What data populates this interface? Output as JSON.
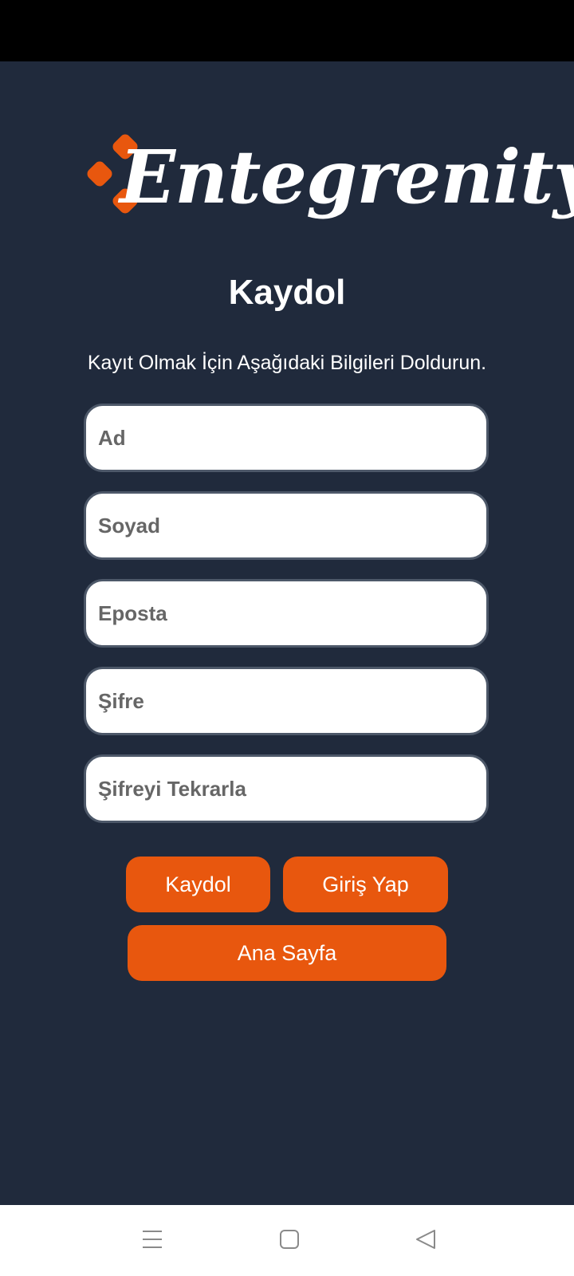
{
  "brand": {
    "name": "Entegrenity",
    "accent_color": "#e8570e",
    "background_color": "#202a3c"
  },
  "page": {
    "title": "Kaydol",
    "subtitle": "Kayıt Olmak İçin Aşağıdaki Bilgileri Doldurun."
  },
  "form": {
    "first_name": {
      "placeholder": "Ad",
      "value": ""
    },
    "last_name": {
      "placeholder": "Soyad",
      "value": ""
    },
    "email": {
      "placeholder": "Eposta",
      "value": ""
    },
    "password": {
      "placeholder": "Şifre",
      "value": ""
    },
    "password_repeat": {
      "placeholder": "Şifreyi Tekrarla",
      "value": ""
    }
  },
  "buttons": {
    "register": "Kaydol",
    "login": "Giriş Yap",
    "home": "Ana Sayfa"
  },
  "system_nav": {
    "icons": [
      "menu-icon",
      "home-square-icon",
      "back-triangle-icon"
    ]
  }
}
